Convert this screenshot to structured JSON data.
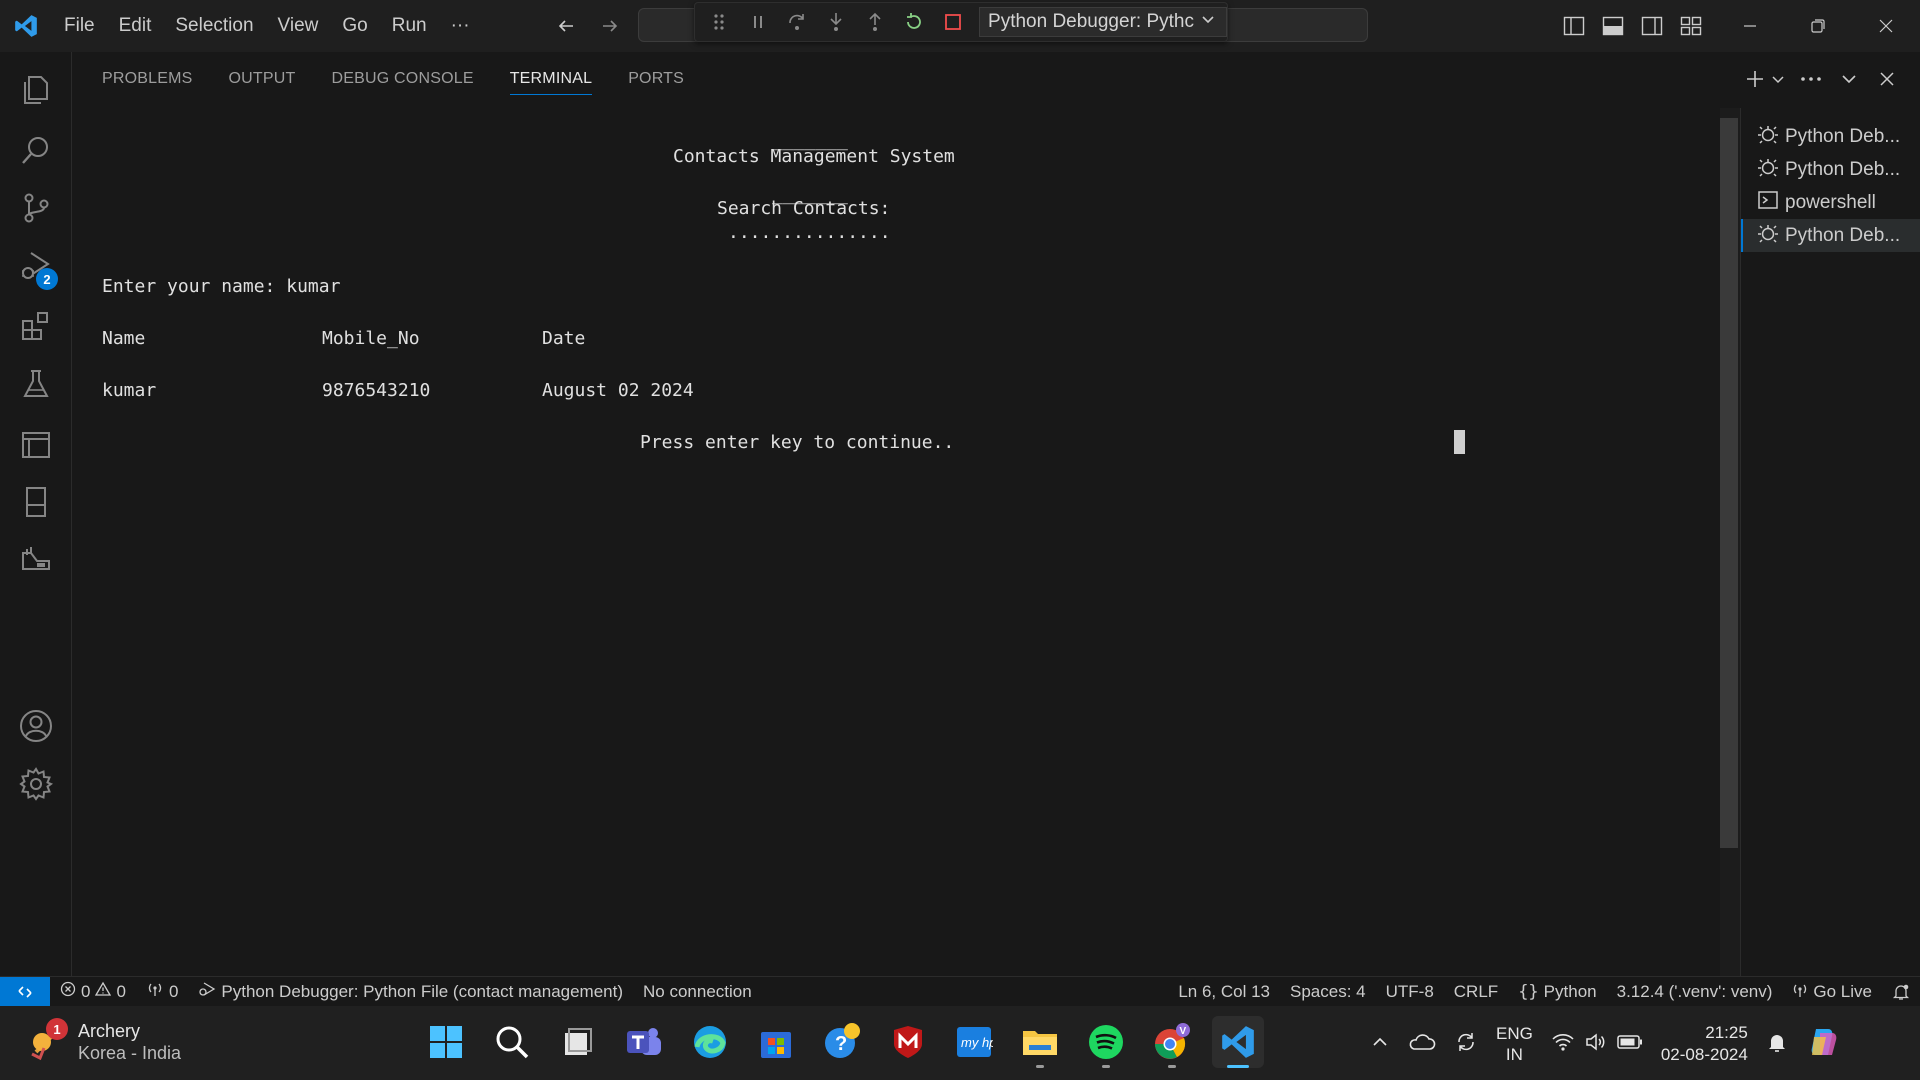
{
  "menu": [
    "File",
    "Edit",
    "Selection",
    "View",
    "Go",
    "Run",
    "···"
  ],
  "debug_config": "Python Debugger: Pythc",
  "tabs": [
    {
      "label": "PROBLEMS",
      "active": false
    },
    {
      "label": "OUTPUT",
      "active": false
    },
    {
      "label": "DEBUG CONSOLE",
      "active": false
    },
    {
      "label": "TERMINAL",
      "active": true
    },
    {
      "label": "PORTS",
      "active": false
    }
  ],
  "terminal": {
    "rule1": "_______",
    "title": "Contacts Management System",
    "rule2": "_______",
    "section": "Search Contacts:",
    "dots": "...............",
    "prompt": "Enter your name: kumar",
    "headers": [
      "Name",
      "Mobile_No",
      "Date"
    ],
    "row": [
      "kumar",
      "9876543210",
      "August 02 2024"
    ],
    "continue": "Press enter key to continue.."
  },
  "terminal_list": [
    {
      "label": "Python Deb...",
      "icon": "debug-icon",
      "selected": false
    },
    {
      "label": "Python Deb...",
      "icon": "debug-icon",
      "selected": false
    },
    {
      "label": "powershell",
      "icon": "terminal-icon",
      "selected": false
    },
    {
      "label": "Python Deb...",
      "icon": "debug-icon",
      "selected": true
    }
  ],
  "activity_badge": "2",
  "status": {
    "errors": "0",
    "warnings": "0",
    "ports": "0",
    "debug": "Python Debugger: Python File (contact management)",
    "connection": "No connection",
    "position": "Ln 6, Col 13",
    "spaces": "Spaces: 4",
    "encoding": "UTF-8",
    "eol": "CRLF",
    "language": "Python",
    "interpreter": "3.12.4 ('.venv': venv)",
    "golive": "Go Live"
  },
  "taskbar": {
    "weather_title": "Archery",
    "weather_sub": "Korea - India",
    "weather_badge": "1",
    "lang1": "ENG",
    "lang2": "IN",
    "time": "21:25",
    "date": "02-08-2024"
  },
  "colors": {
    "accent": "#0078d4",
    "background": "#181818"
  }
}
